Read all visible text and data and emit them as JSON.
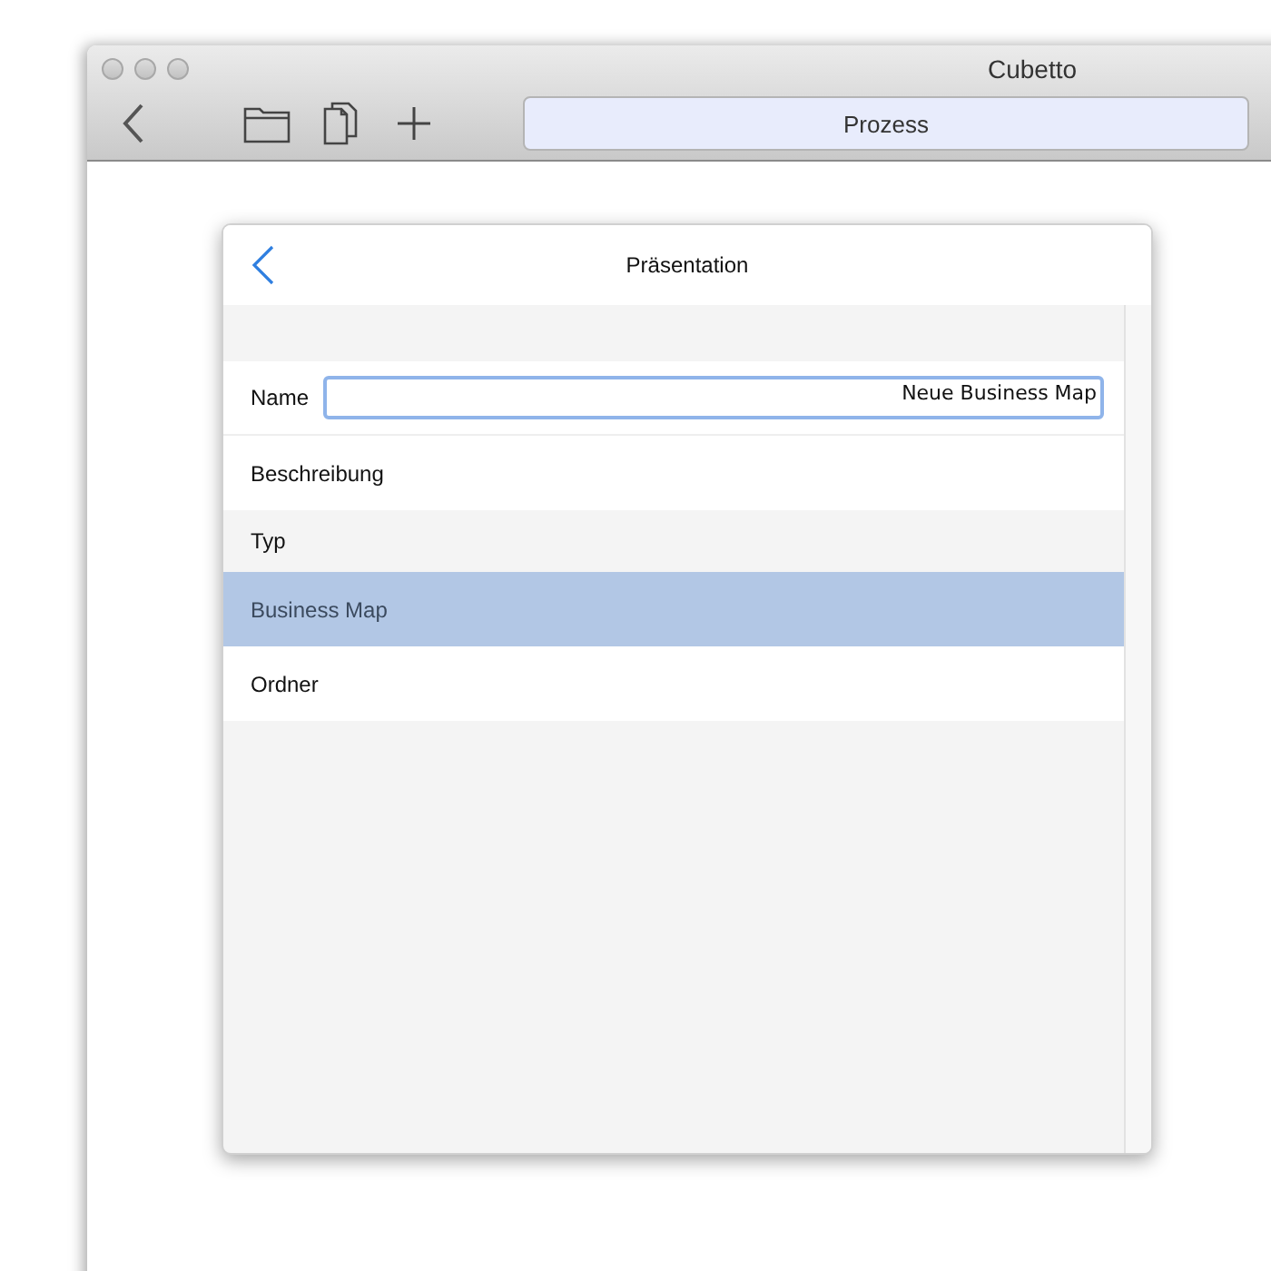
{
  "window": {
    "title": "Cubetto"
  },
  "toolbar": {
    "segment": "Prozess"
  },
  "dialog": {
    "title": "Präsentation",
    "name_field": {
      "label": "Name",
      "value": "Neue Business Map"
    },
    "rows": [
      {
        "kind": "item",
        "label": "Beschreibung",
        "selected": false
      },
      {
        "kind": "section",
        "label": "Typ"
      },
      {
        "kind": "item",
        "label": "Business Map",
        "selected": true
      },
      {
        "kind": "item",
        "label": "Ordner",
        "selected": false
      }
    ]
  }
}
